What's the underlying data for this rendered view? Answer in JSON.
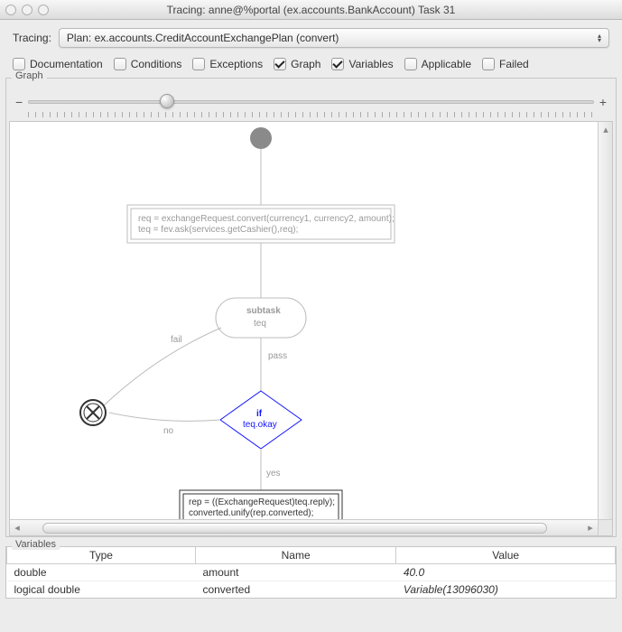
{
  "titlebar": {
    "title": "Tracing: anne@%portal (ex.accounts.BankAccount) Task 31"
  },
  "toolbar": {
    "tracing_label": "Tracing:",
    "plan_selected": "Plan: ex.accounts.CreditAccountExchangePlan (convert)"
  },
  "checks": {
    "documentation": "Documentation",
    "conditions": "Conditions",
    "exceptions": "Exceptions",
    "graph": "Graph",
    "variables": "Variables",
    "applicable": "Applicable",
    "failed": "Failed"
  },
  "group_graph_label": "Graph",
  "slider": {
    "minus": "−",
    "plus": "+"
  },
  "graph": {
    "box1_line1": "req = exchangeRequest.convert(currency1, currency2, amount);",
    "box1_line2": "teq = fev.ask(services.getCashier(),req);",
    "subtask_title": "subtask",
    "subtask_sub": "teq",
    "edge_fail": "fail",
    "edge_pass": "pass",
    "edge_no": "no",
    "edge_yes": "yes",
    "if_label": "if",
    "if_expr": "teq.okay",
    "box2_line1": "rep = ((ExchangeRequest)teq.reply);",
    "box2_line2": "converted.unify(rep.converted);"
  },
  "group_vars_label": "Variables",
  "vars_table": {
    "headers": {
      "type": "Type",
      "name": "Name",
      "value": "Value"
    },
    "rows": [
      {
        "type": "double",
        "name": "amount",
        "value": "40.0"
      },
      {
        "type": "logical double",
        "name": "converted",
        "value": "Variable(13096030)"
      }
    ]
  }
}
